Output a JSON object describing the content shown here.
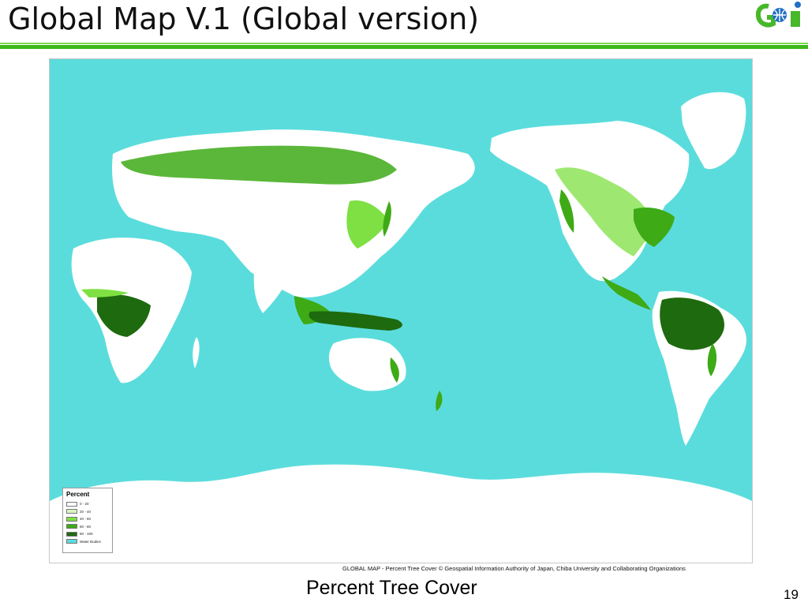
{
  "slide": {
    "title": "Global Map V.1 (Global version)",
    "caption": "Percent Tree Cover",
    "page_number": "19",
    "logo_text": "GSI"
  },
  "map": {
    "credit": "GLOBAL MAP - Percent Tree Cover © Geospatial Information Authority of Japan, Chiba University and Collaborating Organizations",
    "legend": {
      "title": "Percent",
      "items": [
        {
          "label": "0 - 20",
          "color": "#ffffff"
        },
        {
          "label": "20 - 40",
          "color": "#d8f5c0"
        },
        {
          "label": "40 - 60",
          "color": "#7ee043"
        },
        {
          "label": "60 - 80",
          "color": "#3eaa16"
        },
        {
          "label": "80 - 100",
          "color": "#1e6a0e"
        },
        {
          "label": "Water Bodies",
          "color": "#5bdcdc"
        }
      ]
    }
  },
  "colors": {
    "water": "#5bdcdc",
    "land": "#ffffff",
    "title_rule": "#3cb81a",
    "logo_green": "#46b82a",
    "logo_blue": "#1f6fc4"
  }
}
